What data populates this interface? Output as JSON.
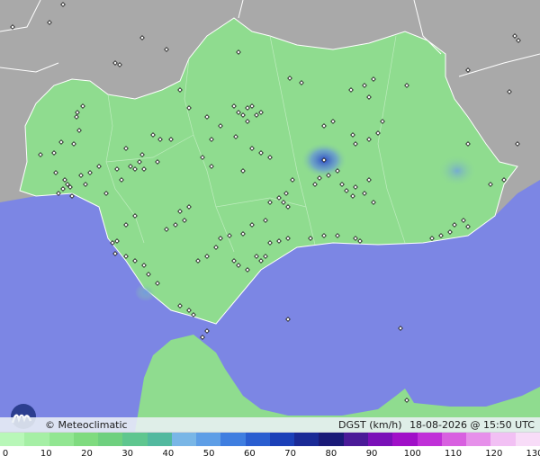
{
  "map": {
    "title": "DGST (km/h)",
    "timestamp": "18-08-2026 @ 15:50 UTC",
    "credit": "© Meteoclimatic",
    "colors": {
      "sea": "#7c86e4",
      "land": "#8fdc8f",
      "outside": "#a7a7a7",
      "border": "#ffffff",
      "station": "#1a1a1a",
      "gust_hotspot": "#3b55d8"
    }
  },
  "scale": {
    "labels": [
      "0",
      "10",
      "20",
      "30",
      "40",
      "50",
      "60",
      "70",
      "80",
      "90",
      "100",
      "110",
      "120",
      "130"
    ],
    "colors": [
      "#b8f7b8",
      "#a5efa5",
      "#92e692",
      "#7fdb7f",
      "#6fd07f",
      "#5fc68f",
      "#52b99f",
      "#79b6e6",
      "#5e9ee6",
      "#3f7ee0",
      "#2a5ed0",
      "#1b40b8",
      "#1a2a96",
      "#1a1a78",
      "#4a1a98",
      "#7a10b8",
      "#a010c8",
      "#c030d8",
      "#d860e0",
      "#e690ea",
      "#f2c0f4",
      "#f8dcf8"
    ]
  }
}
